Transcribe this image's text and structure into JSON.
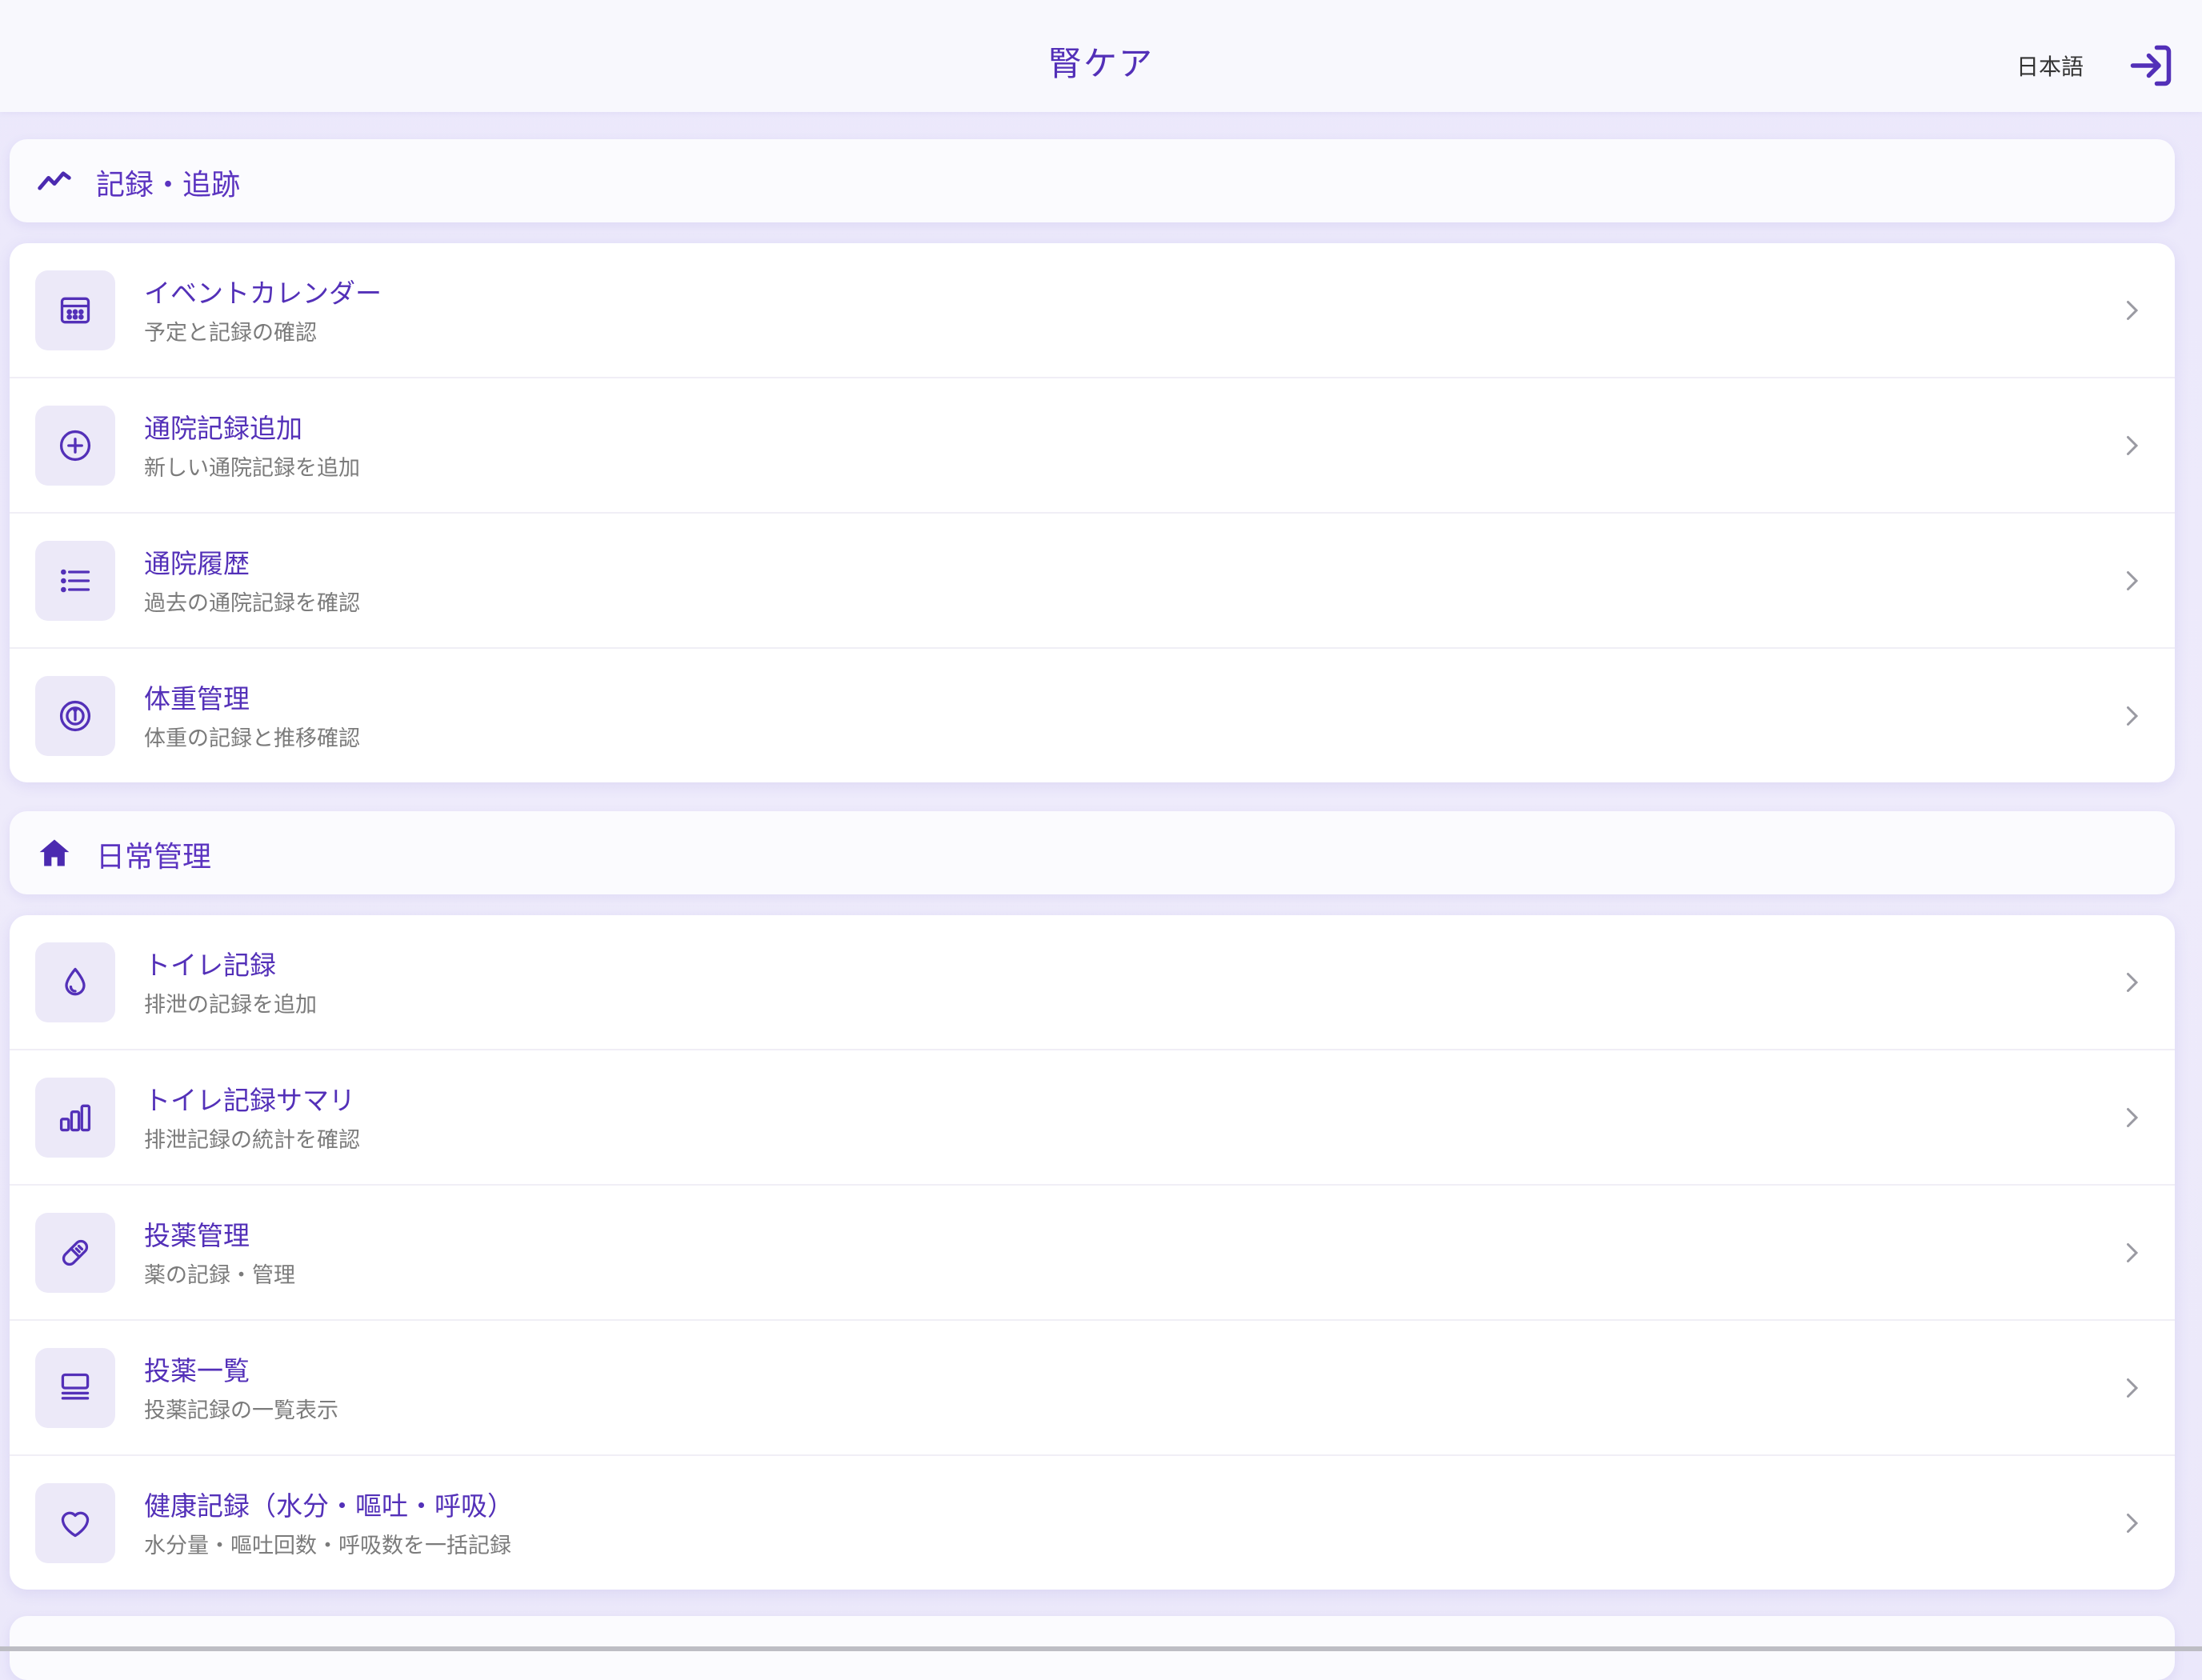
{
  "header": {
    "title": "腎ケア",
    "language": "日本語",
    "logout_icon": "login-arrow-icon"
  },
  "colors": {
    "accent": "#5330b8",
    "icon_bg": "#ece9f8",
    "page_bg": "#ece9fb"
  },
  "sections": [
    {
      "title": "記録・追跡",
      "icon": "trend-line-icon",
      "items": [
        {
          "title": "イベントカレンダー",
          "subtitle": "予定と記録の確認",
          "icon": "calendar-icon"
        },
        {
          "title": "通院記録追加",
          "subtitle": "新しい通院記録を追加",
          "icon": "plus-circle-icon"
        },
        {
          "title": "通院履歴",
          "subtitle": "過去の通院記録を確認",
          "icon": "list-icon"
        },
        {
          "title": "体重管理",
          "subtitle": "体重の記録と推移確認",
          "icon": "gauge-icon"
        }
      ]
    },
    {
      "title": "日常管理",
      "icon": "home-icon",
      "items": [
        {
          "title": "トイレ記録",
          "subtitle": "排泄の記録を追加",
          "icon": "droplet-icon"
        },
        {
          "title": "トイレ記録サマリ",
          "subtitle": "排泄記録の統計を確認",
          "icon": "bar-chart-icon"
        },
        {
          "title": "投薬管理",
          "subtitle": "薬の記録・管理",
          "icon": "pill-icon"
        },
        {
          "title": "投薬一覧",
          "subtitle": "投薬記録の一覧表示",
          "icon": "list-box-icon"
        },
        {
          "title": "健康記録（水分・嘔吐・呼吸）",
          "subtitle": "水分量・嘔吐回数・呼吸数を一括記録",
          "icon": "heart-icon"
        }
      ]
    }
  ]
}
